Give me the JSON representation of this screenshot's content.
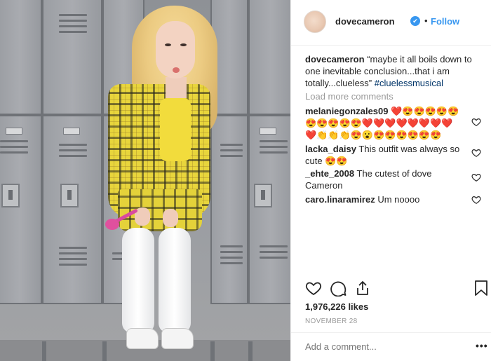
{
  "header": {
    "username": "dovecameron",
    "verified_mark": "✔",
    "separator": "•",
    "follow_label": "Follow"
  },
  "caption": {
    "username": "dovecameron",
    "text": "“maybe it all boils down to one inevitable conclusion...that i am totally...clueless”",
    "hashtag": "#cluelessmusical"
  },
  "load_more_label": "Load more comments",
  "comments": [
    {
      "username": "melaniegonzales09",
      "text": "❤️😍😍😍😍😍😍😍😍😍😍❤️❤️❤️❤️❤️❤️❤️❤️❤️👏👏👏😍😮😍😍😍😍😍😍"
    },
    {
      "username": "lacka_daisy",
      "text": "This outfit was always so cute 😍😍"
    },
    {
      "username": "_ehte_2008",
      "text": "The cutest of dove Cameron"
    },
    {
      "username": "caro.linaramirez",
      "text": "Um noooo"
    }
  ],
  "likes": "1,976,226 likes",
  "date": "NOVEMBER 28",
  "add_comment_placeholder": "Add a comment...",
  "more_label": "•••",
  "icons": {
    "like": "heart-icon",
    "comment": "comment-icon",
    "share": "share-icon",
    "save": "bookmark-icon",
    "comment_like": "heart-icon"
  },
  "colors": {
    "accent": "#3897f0",
    "text": "#262626",
    "muted": "#999999",
    "hashtag": "#003569"
  }
}
